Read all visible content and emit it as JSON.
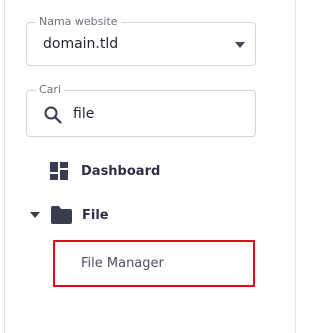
{
  "website_select": {
    "label": "Nama website",
    "value": "domain.tld",
    "caret_icon": "caret-down-icon"
  },
  "search": {
    "label": "Cari",
    "value": "file",
    "icon": "search-icon"
  },
  "nav": {
    "dashboard": {
      "label": "Dashboard",
      "icon": "dashboard-icon"
    },
    "file": {
      "label": "File",
      "icon": "folder-icon",
      "expanded": true,
      "children": [
        {
          "label": "File Manager",
          "highlighted": true
        }
      ]
    }
  },
  "colors": {
    "highlight_border": "#e00b1c",
    "text_primary": "#2f2f45",
    "icon": "#3b3b50",
    "field_border": "#d5d5dd"
  }
}
